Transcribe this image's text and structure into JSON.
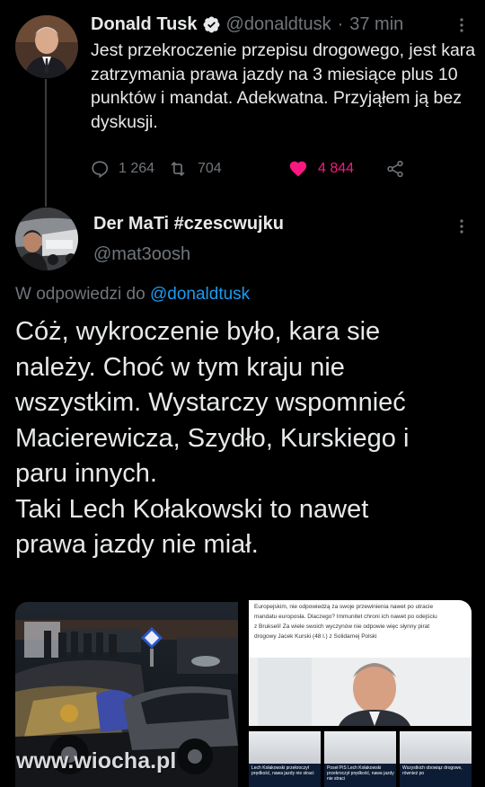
{
  "tweet": {
    "author_name": "Donald Tusk",
    "author_handle": "@donaldtusk",
    "separator": "·",
    "time": "37 min",
    "text": "Jest przekroczenie przepisu drogowego, jest kara zatrzymania prawa jazdy na 3 miesiące plus 10 punktów i mandat. Adekwatna. Przyjąłem ją bez dyskusji.",
    "replies": "1 264",
    "retweets": "704",
    "likes": "4 844"
  },
  "reply": {
    "author_name": "Der MaTi #czescwujku",
    "author_handle": "@mat3oosh",
    "reply_prefix": "W odpowiedzi do",
    "reply_mention": "@donaldtusk",
    "text_lines": [
      "Cóż, wykroczenie było, kara sie",
      "należy. Choć w tym kraju nie",
      "wszystkim. Wystarczy wspomnieć",
      "Macierewicza, Szydło, Kurskiego i",
      "paru innych.",
      "Taki Lech Kołakowski to nawet",
      "prawa jazdy nie miał."
    ]
  },
  "media": {
    "article_lines": [
      "Europejskim, nie odpowiedzą za swoje przewinienia nawet po utracie",
      "mandatu europosła. Dlaczego? Immunitet chroni ich nawet po odejściu",
      "z Brukseli! Za wiele swoich wyczynów nie odpowie więc słynny pirat",
      "drogowy Jacek Kurski (48 l.) z Solidarnej Polski"
    ],
    "thumb_captions": [
      "Lech Kołakowski przekroczył prędkość, nawa jazdy nie straci",
      "Poseł PiS Lech Kołakowski przekroczył prędkość, nawa jazdy nie straci",
      "Wszystkich obowiąz drogowe, również po"
    ]
  },
  "watermark": "www.wiocha.pl",
  "colors": {
    "background": "#000000",
    "text": "#e7e9ea",
    "muted": "#71767b",
    "link": "#1d9bf0",
    "like": "#f91880",
    "verified": "#1d9bf0"
  },
  "icons": {
    "verified": "verified-badge-icon",
    "reply": "reply-icon",
    "retweet": "retweet-icon",
    "like": "heart-icon",
    "share": "share-icon",
    "more": "more-vertical-icon"
  }
}
